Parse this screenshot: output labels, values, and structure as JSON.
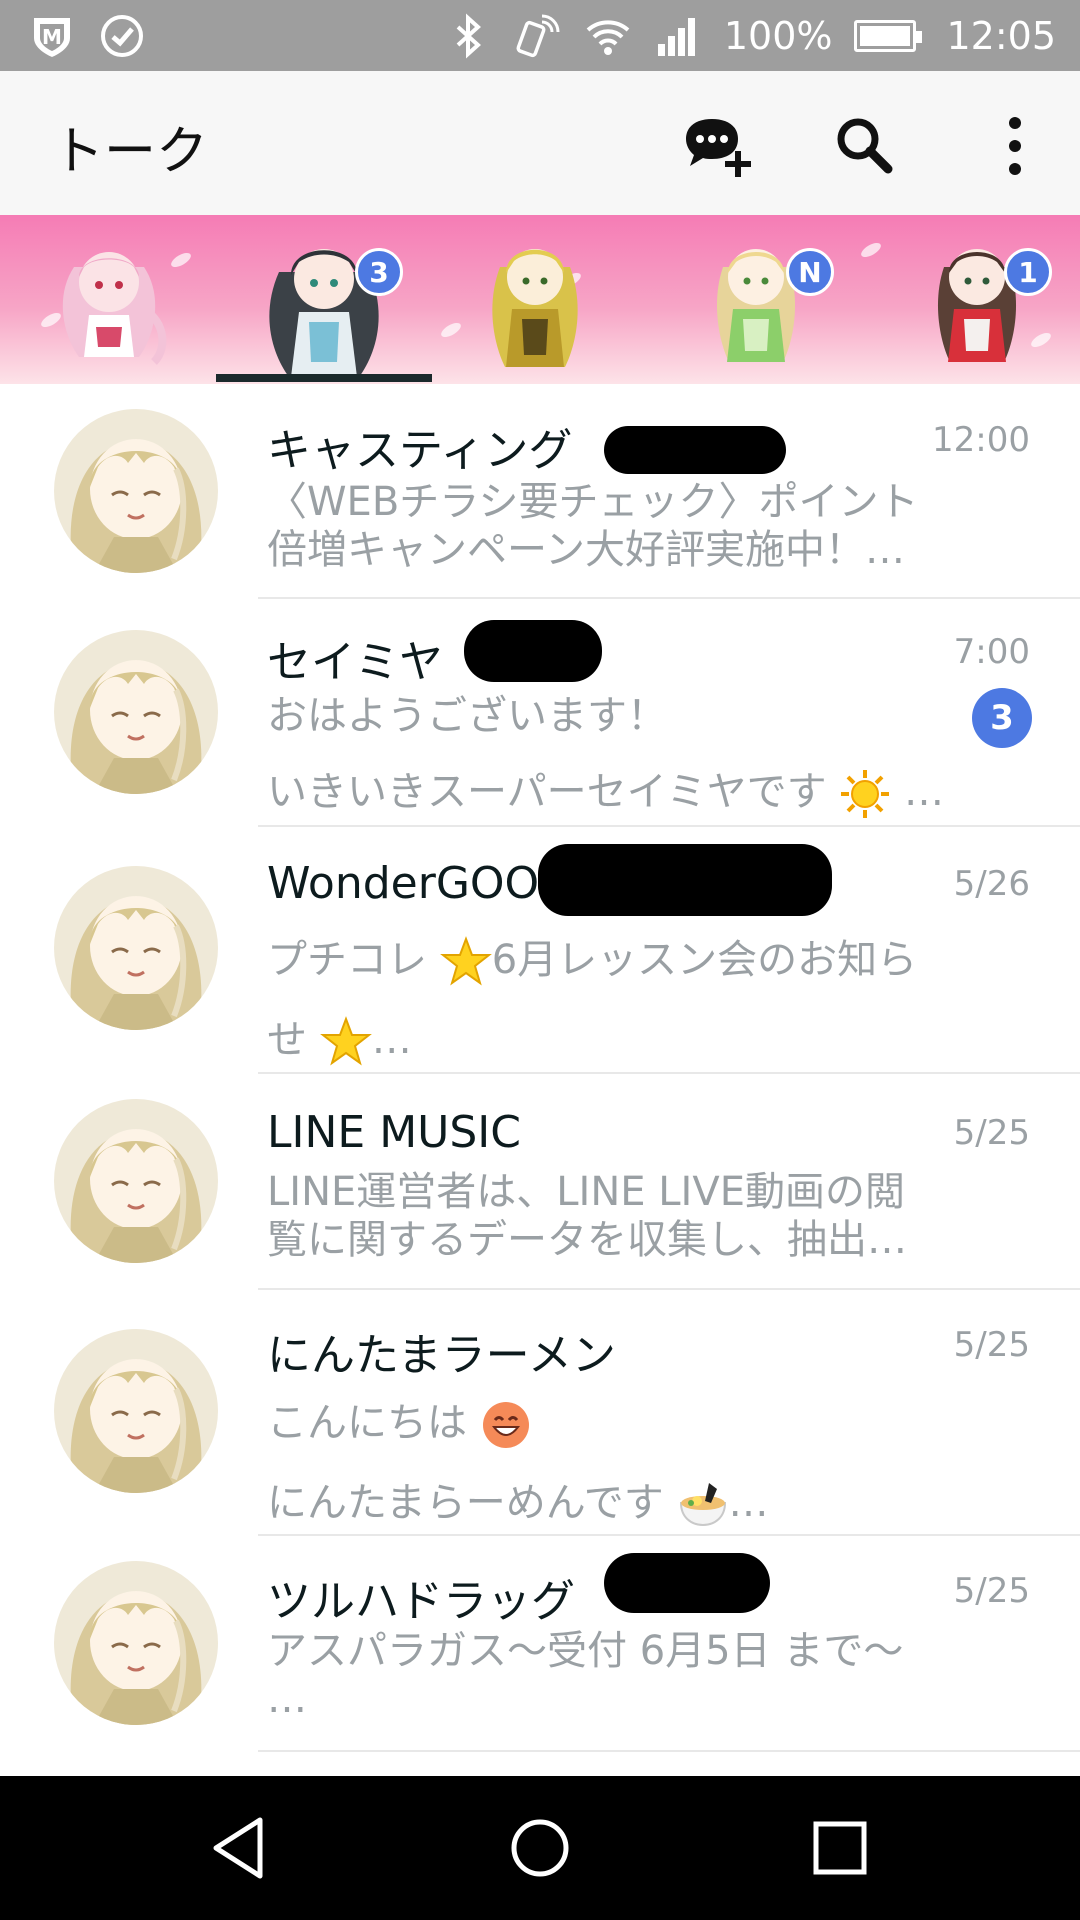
{
  "status_bar": {
    "battery": "100%",
    "battery_level": 1.0,
    "time": "12:05",
    "icons": [
      "shield-app-icon",
      "check-circle-icon",
      "bluetooth-icon",
      "nfc-phone-icon",
      "wifi-icon",
      "signal-icon",
      "battery-icon"
    ]
  },
  "app_bar": {
    "title": "トーク",
    "actions": [
      "new-chat-icon",
      "search-icon",
      "more-icon"
    ]
  },
  "character_tabs": {
    "selected_index": 1,
    "badges": [
      {
        "index": 1,
        "label": "3"
      },
      {
        "index": 3,
        "label": "N"
      },
      {
        "index": 4,
        "label": "1"
      }
    ]
  },
  "chats": [
    {
      "name": "キャスティング",
      "time": "12:00",
      "message_lines": [
        "〈WEBチラシ要チェック〉ポイント",
        "倍増キャンペーン大好評実施中！…"
      ]
    },
    {
      "name": "セイミヤ",
      "time": "7:00",
      "unread": "3",
      "message_lines": [
        "おはようございます！",
        "いきいきスーパーセイミヤです"
      ],
      "ellipsis": "…"
    },
    {
      "name": "WonderGOO",
      "time": "5/26",
      "message_lines": [
        "プチコレ",
        "6月レッスン会のお知ら",
        "せ"
      ],
      "ellipsis": "…"
    },
    {
      "name": "LINE MUSIC",
      "time": "5/25",
      "message_lines": [
        "LINE運営者は、LINE LIVE動画の閲",
        "覧に関するデータを収集し、抽出…"
      ]
    },
    {
      "name": "にんたまラーメン",
      "time": "5/25",
      "message_lines": [
        "こんにちは",
        "にんたまらーめんです"
      ],
      "ellipsis": "…"
    },
    {
      "name": "ツルハドラッグ",
      "time": "5/25",
      "message_lines": [
        "アスパラガス〜受付 6月5日 まで〜",
        "…"
      ]
    }
  ],
  "colors": {
    "status_bar": "#9e9e9e",
    "app_bar": "#f7f7f7",
    "strip_top": "#f57cb5",
    "badge": "#4d79e2",
    "text_primary": "#0d1b1e",
    "text_secondary": "#9aa0a4"
  }
}
